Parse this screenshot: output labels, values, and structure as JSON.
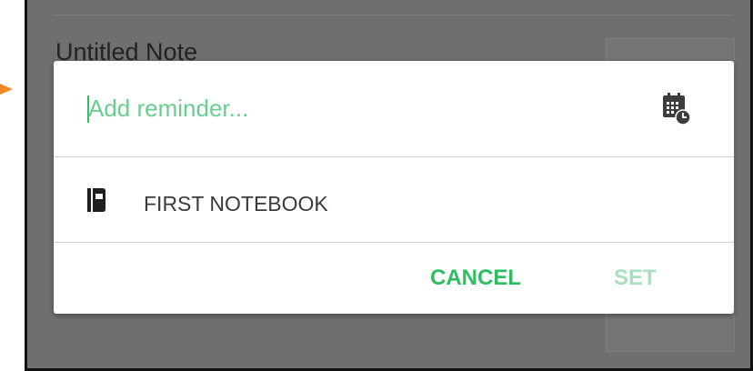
{
  "background": {
    "note_title": "Untitled Note"
  },
  "dialog": {
    "reminder": {
      "value": "",
      "placeholder": "Add reminder...",
      "calendar_icon": "calendar-clock-icon"
    },
    "notebook": {
      "icon": "notebook-icon",
      "label": "FIRST NOTEBOOK"
    },
    "actions": {
      "cancel_label": "CANCEL",
      "set_label": "SET"
    }
  },
  "colors": {
    "accent": "#2dbe60",
    "accent_disabled": "#a8e0bd",
    "scrim": "#6f6f6f",
    "pointer_arrow": "#f08a24"
  }
}
